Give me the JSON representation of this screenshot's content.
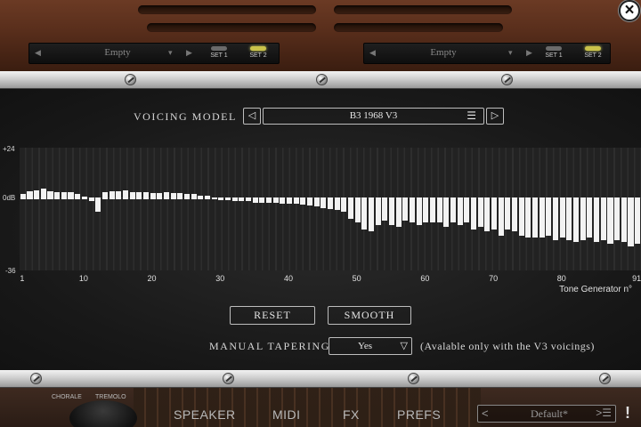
{
  "top": {
    "left_preset": {
      "name": "Empty",
      "set1": "SET 1",
      "set2": "SET 2",
      "active_set": 2
    },
    "right_preset": {
      "name": "Empty",
      "set1": "SET 1",
      "set2": "SET 2",
      "active_set": 2
    },
    "close_icon": "close-icon"
  },
  "voicing": {
    "label": "VOICING MODEL",
    "prev_icon": "◁",
    "next_icon": "▷",
    "selected": "B3 1968 V3",
    "menu_icon": "☰"
  },
  "chart_data": {
    "type": "bar",
    "y_top_label": "+24",
    "y_zero_label": "0dB",
    "y_bottom_label": "-36",
    "ylim": [
      -36,
      24
    ],
    "x_ticks": [
      "1",
      "10",
      "20",
      "30",
      "40",
      "50",
      "60",
      "70",
      "80",
      "91"
    ],
    "xlabel": "Tone Generator n°",
    "tone_generator_count": 91,
    "values": [
      1.5,
      3,
      3.5,
      4,
      3,
      2.5,
      2.5,
      2.5,
      1.5,
      0.5,
      -1,
      -6,
      2.5,
      3,
      3,
      3.5,
      2.5,
      2.5,
      2.5,
      2,
      2,
      2.5,
      2,
      2,
      1.5,
      1.5,
      1,
      1,
      0,
      -0.5,
      -0.5,
      -1,
      -1,
      -1,
      -1.5,
      -1.5,
      -1.5,
      -1.5,
      -2,
      -2,
      -2,
      -2.5,
      -3,
      -3.5,
      -4,
      -4.5,
      -5,
      -6,
      -9,
      -11,
      -14,
      -15,
      -12,
      -10,
      -12,
      -13,
      -10,
      -11,
      -12,
      -11,
      -11,
      -11,
      -13,
      -11,
      -12,
      -11,
      -14,
      -13,
      -15,
      -14,
      -17,
      -14,
      -15,
      -17,
      -18,
      -18,
      -18,
      -17,
      -19,
      -18,
      -19,
      -20,
      -19,
      -18,
      -20,
      -19,
      -21,
      -19,
      -20,
      -22,
      -21
    ]
  },
  "buttons": {
    "reset": "RESET",
    "smooth": "SMOOTH"
  },
  "tapering": {
    "label": "MANUAL TAPERING",
    "value": "Yes",
    "caret_icon": "▽",
    "note": "(Avalable only with the V3 voicings)"
  },
  "bottom": {
    "knob_left": "CHORALE",
    "knob_right": "TREMOLO",
    "tabs": [
      "SPEAKER",
      "MIDI",
      "FX",
      "PREFS"
    ],
    "preset_prev_icon": "<",
    "preset_name": "Default*",
    "preset_next_icon": ">☰",
    "alert_icon": "!"
  }
}
